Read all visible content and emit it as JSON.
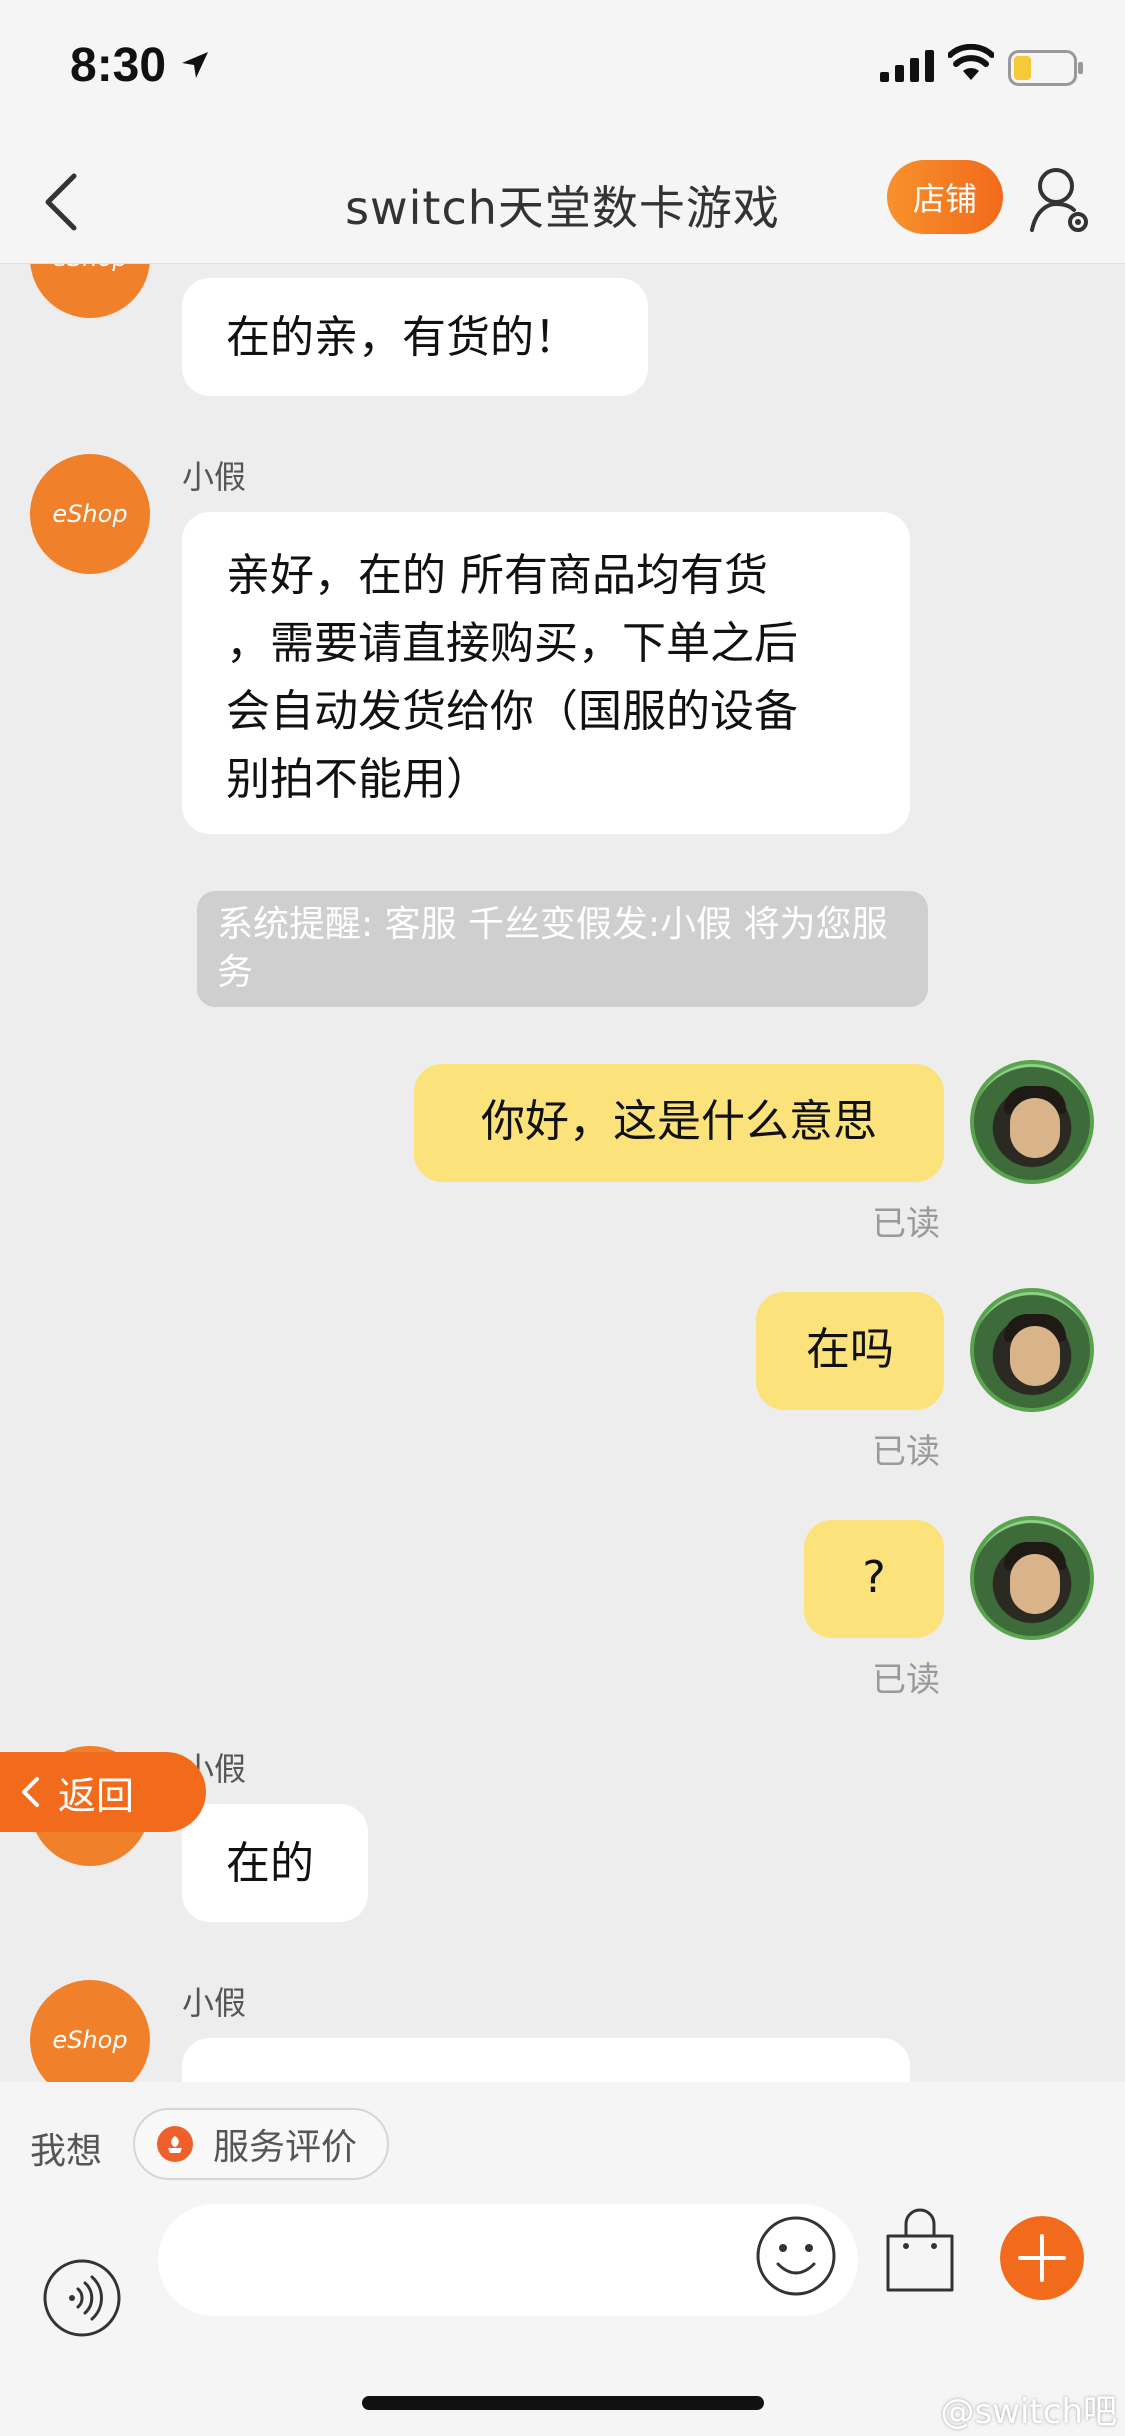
{
  "status_bar": {
    "time": "8:30"
  },
  "nav": {
    "title": "switch天堂数卡游戏",
    "store_label": "店铺"
  },
  "messages": {
    "m1_text": "在的亲，有货的！",
    "m2_sender": "小假",
    "m2_lines": [
      "亲好，在的  所有商品均有货",
      "，需要请直接购买，下单之后",
      "会自动发货给你（国服的设备",
      "别拍不能用）"
    ],
    "system": "系统提醒: 客服 千丝变假发:小假 将为您服务",
    "m3_text": "你好，这是什么意思",
    "m3_status": "已读",
    "m4_text": "在吗",
    "m4_status": "已读",
    "m5_text": "?",
    "m5_status": "已读",
    "m6_sender": "小假",
    "m6_text": "在的",
    "m7_sender": "小假",
    "eshop_avatar_label": "eShop"
  },
  "return_label": "返回",
  "quick": {
    "label": "我想",
    "service_review": "服务评价"
  },
  "watermark": "@switch吧",
  "colors": {
    "accent": "#f26a1b",
    "self_bubble": "#fbe27a",
    "system_note": "#cfcfcf"
  },
  "icons": [
    "back-arrow-icon",
    "location-arrow-icon",
    "signal-icon",
    "wifi-icon",
    "battery-icon",
    "profile-settings-icon",
    "voice-icon",
    "emoji-icon",
    "shopping-bag-icon",
    "plus-icon",
    "service-review-icon"
  ]
}
